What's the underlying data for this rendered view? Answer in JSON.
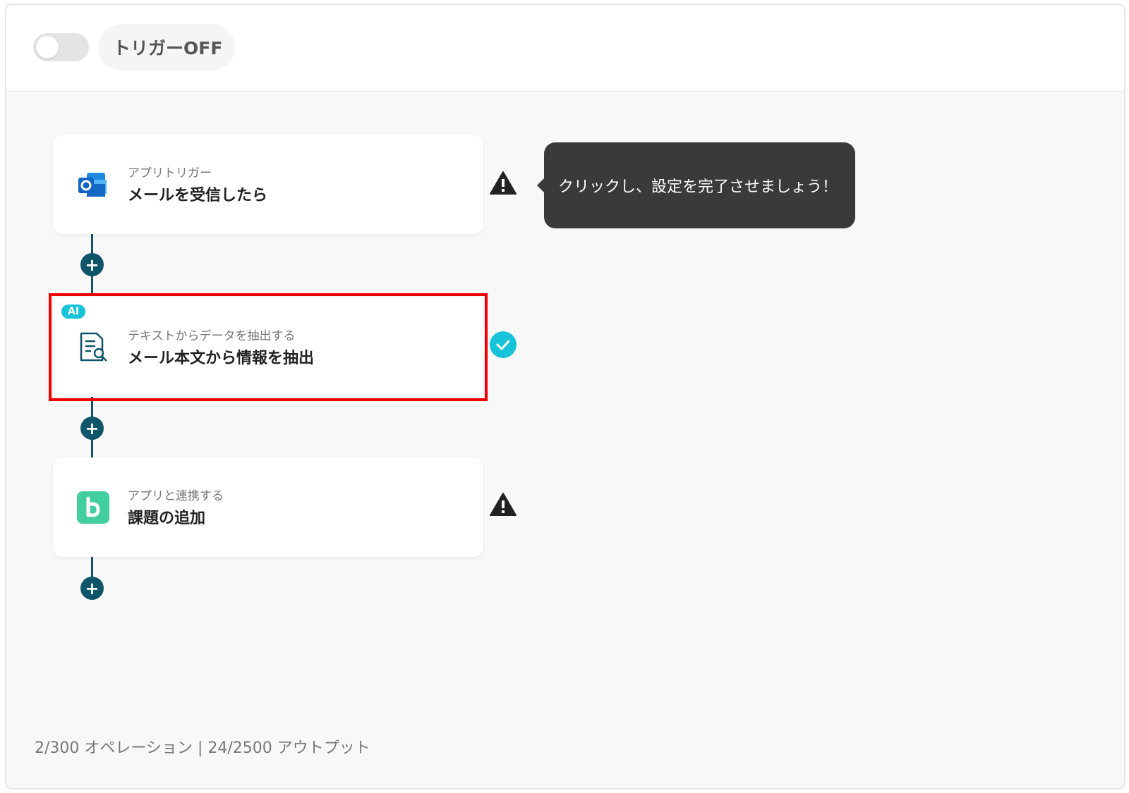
{
  "header": {
    "trigger_label": "トリガーOFF",
    "trigger_on": false
  },
  "tooltip": {
    "text": "クリックし、設定を完了させましょう！"
  },
  "steps": [
    {
      "subtitle": "アプリトリガー",
      "title": "メールを受信したら",
      "icon": "outlook-icon",
      "status": "warning"
    },
    {
      "badge": "AI",
      "subtitle": "テキストからデータを抽出する",
      "title": "メール本文から情報を抽出",
      "icon": "document-search-icon",
      "status": "complete",
      "highlighted": true
    },
    {
      "subtitle": "アプリと連携する",
      "title": "課題の追加",
      "icon": "backlog-icon",
      "status": "warning"
    }
  ],
  "footer": {
    "usage": "2/300 オペレーション | 24/2500 アウトプット"
  },
  "colors": {
    "connector": "#10546a",
    "complete": "#17c3d9",
    "highlight": "#ee0000",
    "tooltip_bg": "#3a3a3a"
  }
}
